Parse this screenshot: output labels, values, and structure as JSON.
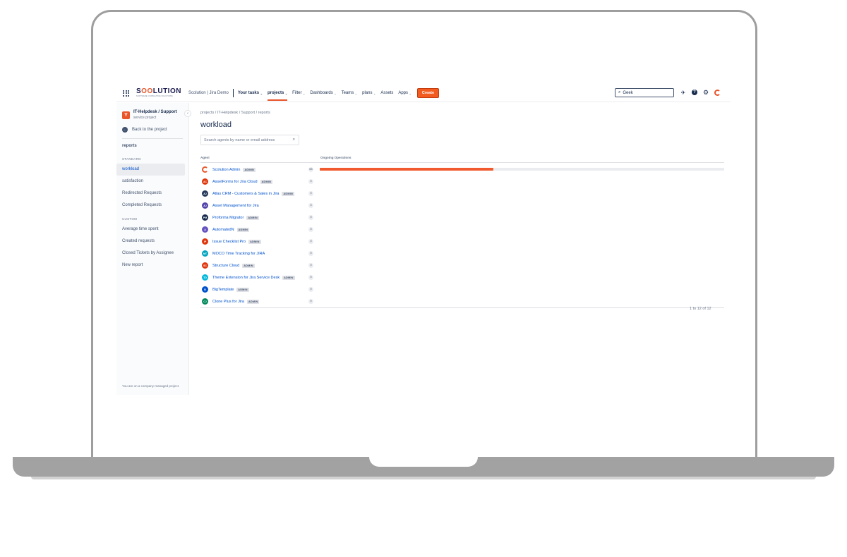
{
  "topnav": {
    "logo_main": "S",
    "logo_o": "OO",
    "logo_rest": "LUTION",
    "logo_sub": "SOFTWARE CONSULTING SOLUTIONS",
    "site_name": "Scolution | Jira Demo",
    "items": [
      {
        "label": "Your tasks",
        "dropdown": true
      },
      {
        "label": "projects",
        "dropdown": true,
        "active": true
      },
      {
        "label": "Filter",
        "dropdown": true
      },
      {
        "label": "Dashboards",
        "dropdown": true
      },
      {
        "label": "Teams",
        "dropdown": true
      },
      {
        "label": "plans",
        "dropdown": true
      },
      {
        "label": "Assets",
        "dropdown": false
      },
      {
        "label": "Apps",
        "dropdown": true
      }
    ],
    "create_label": "Create",
    "search_value": "Geek",
    "accent_color": "#f25c21"
  },
  "sidebar": {
    "project_name": "IT-Helpdesk / Support",
    "project_type": "service project",
    "back_label": "Back to the project",
    "section_title": "reports",
    "standard_label": "STANDARD",
    "standard_items": [
      "workload",
      "satisfaction",
      "Redirected Requests",
      "Completed Requests"
    ],
    "custom_label": "CUSTOM",
    "custom_items": [
      "Average time spent",
      "Created requests",
      "Closed Tickets by Assignee"
    ],
    "new_report_label": "New report",
    "footer": "You are on a company-managed project."
  },
  "main": {
    "breadcrumb": "projects  /  IT-Helpdesk / Support  /  reports",
    "title": "workload",
    "search_placeholder": "Search agents by name or email address",
    "col_agent": "Agent",
    "col_ops": "Ongoing Operations",
    "pager": "1 to 12 of 12",
    "agents": [
      {
        "name": "Scolution Admin",
        "admin": true,
        "count": "65",
        "initials": "",
        "color": "#ffffff",
        "ring": true,
        "load": 0.43
      },
      {
        "name": "AssetForms for Jira Cloud",
        "admin": true,
        "count": "0",
        "initials": "AC",
        "color": "#de350b",
        "load": 0
      },
      {
        "name": "Atlas CRM - Customers & Sales in Jira",
        "admin": true,
        "count": "0",
        "initials": "AJ",
        "color": "#253858",
        "load": 0
      },
      {
        "name": "Asset Management for Jira",
        "admin": false,
        "count": "0",
        "initials": "AJ",
        "color": "#5243aa",
        "load": 0
      },
      {
        "name": "Proforma Migrator",
        "admin": true,
        "count": "0",
        "initials": "PM",
        "color": "#172b4d",
        "load": 0
      },
      {
        "name": "AutomatedN",
        "admin": true,
        "count": "0",
        "initials": "A",
        "color": "#6554c0",
        "load": 0
      },
      {
        "name": "Issue Checklist Pro",
        "admin": true,
        "count": "0",
        "initials": "IP",
        "color": "#de350b",
        "load": 0
      },
      {
        "name": "MOCO Time Tracking for JIRA",
        "admin": false,
        "count": "0",
        "initials": "MT",
        "color": "#00a3bf",
        "load": 0
      },
      {
        "name": "Structure Cloud",
        "admin": true,
        "count": "0",
        "initials": "SC",
        "color": "#de350b",
        "load": 0
      },
      {
        "name": "Theme Extension for Jira Service Desk",
        "admin": true,
        "count": "0",
        "initials": "TD",
        "color": "#00b8d9",
        "load": 0
      },
      {
        "name": "BigTemplate",
        "admin": true,
        "count": "0",
        "initials": "B",
        "color": "#0052cc",
        "load": 0
      },
      {
        "name": "Clone Plus for Jira",
        "admin": true,
        "count": "0",
        "initials": "CJ",
        "color": "#00875a",
        "load": 0
      }
    ],
    "admin_label": "ADMIN",
    "bar_color": "#f05a2e"
  }
}
